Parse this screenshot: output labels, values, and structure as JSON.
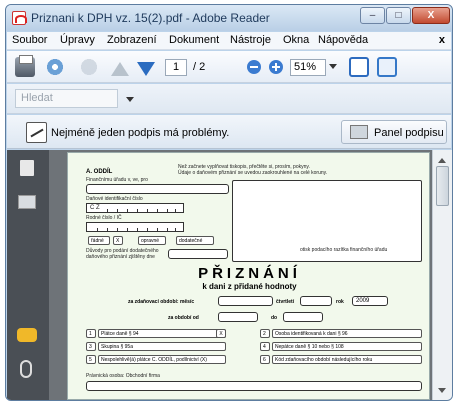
{
  "window": {
    "title": "Priznani k DPH vz. 15(2).pdf - Adobe Reader"
  },
  "menubar": {
    "items": [
      "Soubor",
      "Úpravy",
      "Zobrazení",
      "Dokument",
      "Nástroje",
      "Okna",
      "Nápověda"
    ],
    "close": "x"
  },
  "toolbar": {
    "page_current": "1",
    "page_total": "/ 2",
    "zoom": "51%"
  },
  "find": {
    "placeholder": "Hledat"
  },
  "message": {
    "text": "Nejméně jeden podpis má problémy.",
    "panel_button": "Panel podpisu"
  },
  "doc": {
    "header_note1": "Než začnete vyplňovat tiskopis, přečtěte si, prosím, pokyny.",
    "header_note2": "Údaje o daňovém přiznání se uvedou zaokrouhlené na celé koruny.",
    "section_a": "A. ODDÍL",
    "fin_office": "Finančnímu úřadu v, ve, pro",
    "dic_label": "Daňové identifikační číslo",
    "dic_prefix": "C Z",
    "rc_label": "Rodné číslo / IČ",
    "type_radne": "řádné",
    "type_radne_mark": "X",
    "type_opravne": "opravné",
    "type_dodatecne": "dodatečné",
    "reasons_1": "Důvody pro podání dodatečného",
    "reasons_2": "daňového přiznání zjištěny dne",
    "stamp_label": "otisk podacího razítka finančního úřadu",
    "title": "PŘIZNÁNÍ",
    "subtitle": "k dani z přidané hodnoty",
    "period_label": "za zdaňovací období:  měsíc",
    "quarter_label": "čtvrtletí",
    "year_label": "rok",
    "year_value": "2009",
    "from_label": "za období od",
    "to_label": "do",
    "rows_left": [
      {
        "num": "1",
        "label": "Plátce daně § 94",
        "mark": "X"
      },
      {
        "num": "3",
        "label": "Skupina § 95a",
        "mark": ""
      },
      {
        "num": "5",
        "label": "Nespolehlivě(á) plátce C. ODDÍL, podílnictví (X)",
        "mark": ""
      }
    ],
    "rows_right": [
      {
        "num": "2",
        "label": "Osoba identifikovaná k dani § 96"
      },
      {
        "num": "4",
        "label": "Nepátce daně § 10 nebo § 108"
      },
      {
        "num": "6",
        "label": "Kód zdaňovacího období následujícího roku"
      }
    ],
    "footer_label": "Právnická osoba: Obchodní firma"
  }
}
